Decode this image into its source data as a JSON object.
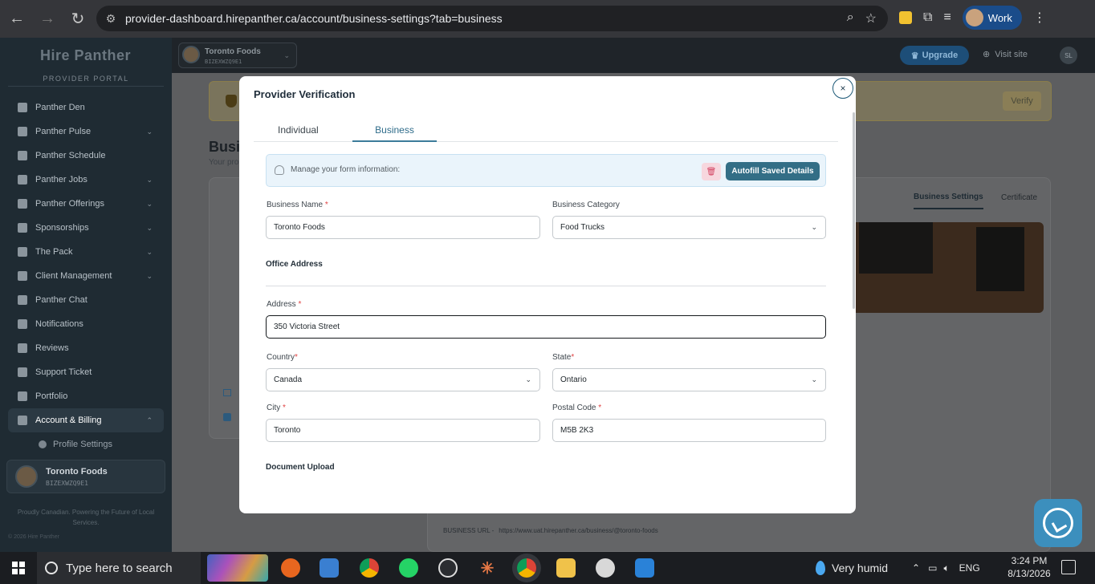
{
  "browser": {
    "url": "provider-dashboard.hirepanther.ca/account/business-settings?tab=business",
    "profile_label": "Work"
  },
  "sidebar": {
    "logo": "Hire Panther",
    "portal_label": "PROVIDER PORTAL",
    "items": [
      {
        "label": "Panther Den",
        "icon": "home-icon"
      },
      {
        "label": "Panther Pulse",
        "icon": "chart-icon",
        "expandable": true
      },
      {
        "label": "Panther Schedule",
        "icon": "calendar-icon"
      },
      {
        "label": "Panther Jobs",
        "icon": "bookmark-icon",
        "expandable": true
      },
      {
        "label": "Panther Offerings",
        "icon": "offerings-icon",
        "expandable": true
      },
      {
        "label": "Sponsorships",
        "icon": "star-icon",
        "expandable": true
      },
      {
        "label": "The Pack",
        "icon": "group-icon",
        "expandable": true
      },
      {
        "label": "Client Management",
        "icon": "clipboard-icon",
        "expandable": true
      },
      {
        "label": "Panther Chat",
        "icon": "chat-icon"
      },
      {
        "label": "Notifications",
        "icon": "bell-icon"
      },
      {
        "label": "Reviews",
        "icon": "star-icon"
      },
      {
        "label": "Support Ticket",
        "icon": "ticket-icon"
      },
      {
        "label": "Portfolio",
        "icon": "briefcase-icon"
      },
      {
        "label": "Account & Billing",
        "icon": "account-icon",
        "expandable": true,
        "active": true
      }
    ],
    "sub_items": [
      {
        "label": "Profile Settings",
        "icon": "user-settings-icon"
      }
    ],
    "card": {
      "name": "Toronto Foods",
      "code": "BIZEXWZQ9E1"
    },
    "footer": "Proudly Canadian. Powering the Future of Local Services.",
    "copyright": "© 2026 Hire Panther"
  },
  "topbar": {
    "workspace_name": "Toronto Foods",
    "workspace_code": "BIZEXWZQ9E1",
    "upgrade_label": "Upgrade",
    "visit_label": "Visit site",
    "user_initials": "SL"
  },
  "background": {
    "verify_label": "Verify",
    "page_title": "Busin",
    "page_subtitle": "Your pro",
    "tab_business_settings": "Business Settings",
    "tab_certificate": "Certificate",
    "business_url_label": "BUSINESS URL -",
    "business_url": "https://www.uat.hirepanther.ca/business/@toronto-foods"
  },
  "modal": {
    "title": "Provider Verification",
    "close": "×",
    "tabs": [
      "Individual",
      "Business"
    ],
    "active_tab": "Business",
    "autofill": {
      "text": "Manage your form information:",
      "button": "Autofill Saved Details"
    },
    "fields": {
      "business_name": {
        "label": "Business Name",
        "required": "*",
        "value": "Toronto Foods"
      },
      "business_category": {
        "label": "Business Category",
        "value": "Food Trucks"
      },
      "office_address_heading": "Office Address",
      "address": {
        "label": "Address",
        "required": "*",
        "value": "350 Victoria Street"
      },
      "country": {
        "label": "Country",
        "required": "*",
        "value": "Canada"
      },
      "state": {
        "label": "State",
        "required": "*",
        "value": "Ontario"
      },
      "city": {
        "label": "City",
        "required": "*",
        "value": "Toronto"
      },
      "postal_code": {
        "label": "Postal Code",
        "required": "*",
        "value": "M5B 2K3"
      },
      "document_upload_heading": "Document Upload"
    }
  },
  "taskbar": {
    "search_placeholder": "Type here to search",
    "weather": "Very humid",
    "language": "ENG",
    "time": "3:24 PM",
    "date": "8/13/2026"
  }
}
